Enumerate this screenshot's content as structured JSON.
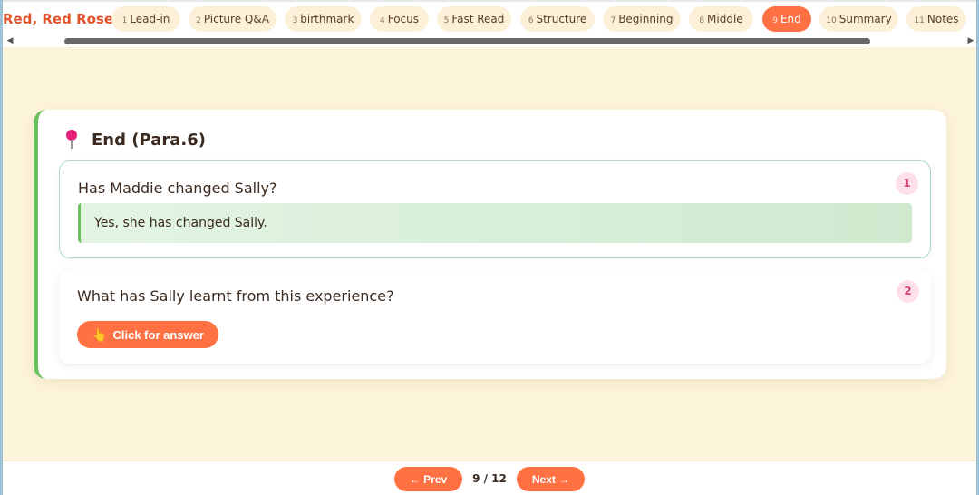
{
  "header": {
    "brand": "Red, Red Rose",
    "tabs": [
      {
        "num": "1",
        "label": "Lead-in"
      },
      {
        "num": "2",
        "label": "Picture Q&A"
      },
      {
        "num": "3",
        "label": "birthmark"
      },
      {
        "num": "4",
        "label": "Focus"
      },
      {
        "num": "5",
        "label": "Fast Read"
      },
      {
        "num": "6",
        "label": "Structure"
      },
      {
        "num": "7",
        "label": "Beginning"
      },
      {
        "num": "8",
        "label": "Middle"
      },
      {
        "num": "9",
        "label": "End"
      },
      {
        "num": "10",
        "label": "Summary"
      },
      {
        "num": "11",
        "label": "Notes"
      }
    ],
    "active_tab": "9",
    "scroll_left_icon": "◀",
    "scroll_right_icon": "▶"
  },
  "card": {
    "icon": "pushpin-icon",
    "title": "End (Para.6)",
    "questions": [
      {
        "num": "1",
        "question": "Has Maddie changed Sally?",
        "answer": "Yes, she has changed Sally."
      },
      {
        "num": "2",
        "question": "What has Sally learnt from this experience?",
        "button_label": "Click for answer",
        "button_icon": "👆"
      }
    ]
  },
  "footer": {
    "prev_label": "← Prev",
    "next_label": "Next →",
    "page": "9 / 12"
  },
  "colors": {
    "accent": "#ff7043",
    "brand": "#e0532a",
    "background": "#fdf4dc",
    "success": "#6cbf5f"
  }
}
